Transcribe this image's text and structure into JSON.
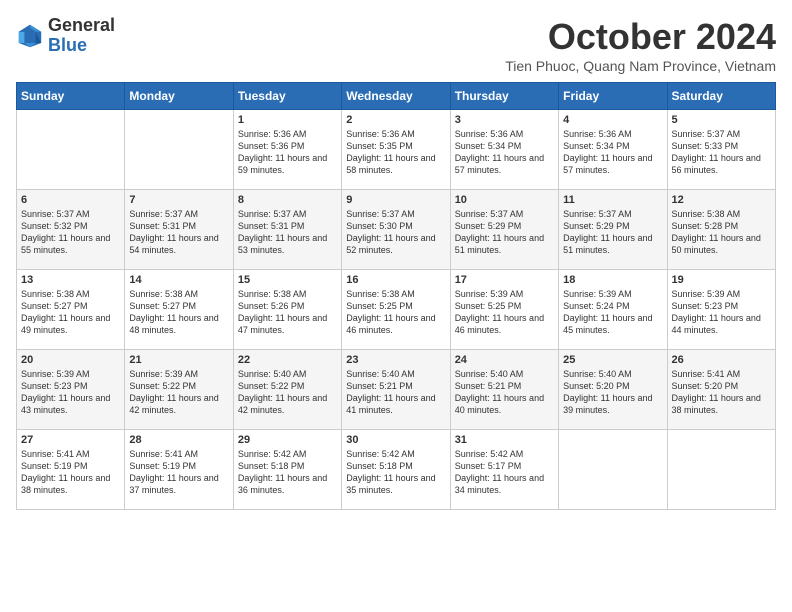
{
  "header": {
    "logo": {
      "general": "General",
      "blue": "Blue"
    },
    "title": "October 2024",
    "location": "Tien Phuoc, Quang Nam Province, Vietnam"
  },
  "weekdays": [
    "Sunday",
    "Monday",
    "Tuesday",
    "Wednesday",
    "Thursday",
    "Friday",
    "Saturday"
  ],
  "weeks": [
    [
      {
        "day": "",
        "sunrise": "",
        "sunset": "",
        "daylight": ""
      },
      {
        "day": "",
        "sunrise": "",
        "sunset": "",
        "daylight": ""
      },
      {
        "day": "1",
        "sunrise": "Sunrise: 5:36 AM",
        "sunset": "Sunset: 5:36 PM",
        "daylight": "Daylight: 11 hours and 59 minutes."
      },
      {
        "day": "2",
        "sunrise": "Sunrise: 5:36 AM",
        "sunset": "Sunset: 5:35 PM",
        "daylight": "Daylight: 11 hours and 58 minutes."
      },
      {
        "day": "3",
        "sunrise": "Sunrise: 5:36 AM",
        "sunset": "Sunset: 5:34 PM",
        "daylight": "Daylight: 11 hours and 57 minutes."
      },
      {
        "day": "4",
        "sunrise": "Sunrise: 5:36 AM",
        "sunset": "Sunset: 5:34 PM",
        "daylight": "Daylight: 11 hours and 57 minutes."
      },
      {
        "day": "5",
        "sunrise": "Sunrise: 5:37 AM",
        "sunset": "Sunset: 5:33 PM",
        "daylight": "Daylight: 11 hours and 56 minutes."
      }
    ],
    [
      {
        "day": "6",
        "sunrise": "Sunrise: 5:37 AM",
        "sunset": "Sunset: 5:32 PM",
        "daylight": "Daylight: 11 hours and 55 minutes."
      },
      {
        "day": "7",
        "sunrise": "Sunrise: 5:37 AM",
        "sunset": "Sunset: 5:31 PM",
        "daylight": "Daylight: 11 hours and 54 minutes."
      },
      {
        "day": "8",
        "sunrise": "Sunrise: 5:37 AM",
        "sunset": "Sunset: 5:31 PM",
        "daylight": "Daylight: 11 hours and 53 minutes."
      },
      {
        "day": "9",
        "sunrise": "Sunrise: 5:37 AM",
        "sunset": "Sunset: 5:30 PM",
        "daylight": "Daylight: 11 hours and 52 minutes."
      },
      {
        "day": "10",
        "sunrise": "Sunrise: 5:37 AM",
        "sunset": "Sunset: 5:29 PM",
        "daylight": "Daylight: 11 hours and 51 minutes."
      },
      {
        "day": "11",
        "sunrise": "Sunrise: 5:37 AM",
        "sunset": "Sunset: 5:29 PM",
        "daylight": "Daylight: 11 hours and 51 minutes."
      },
      {
        "day": "12",
        "sunrise": "Sunrise: 5:38 AM",
        "sunset": "Sunset: 5:28 PM",
        "daylight": "Daylight: 11 hours and 50 minutes."
      }
    ],
    [
      {
        "day": "13",
        "sunrise": "Sunrise: 5:38 AM",
        "sunset": "Sunset: 5:27 PM",
        "daylight": "Daylight: 11 hours and 49 minutes."
      },
      {
        "day": "14",
        "sunrise": "Sunrise: 5:38 AM",
        "sunset": "Sunset: 5:27 PM",
        "daylight": "Daylight: 11 hours and 48 minutes."
      },
      {
        "day": "15",
        "sunrise": "Sunrise: 5:38 AM",
        "sunset": "Sunset: 5:26 PM",
        "daylight": "Daylight: 11 hours and 47 minutes."
      },
      {
        "day": "16",
        "sunrise": "Sunrise: 5:38 AM",
        "sunset": "Sunset: 5:25 PM",
        "daylight": "Daylight: 11 hours and 46 minutes."
      },
      {
        "day": "17",
        "sunrise": "Sunrise: 5:39 AM",
        "sunset": "Sunset: 5:25 PM",
        "daylight": "Daylight: 11 hours and 46 minutes."
      },
      {
        "day": "18",
        "sunrise": "Sunrise: 5:39 AM",
        "sunset": "Sunset: 5:24 PM",
        "daylight": "Daylight: 11 hours and 45 minutes."
      },
      {
        "day": "19",
        "sunrise": "Sunrise: 5:39 AM",
        "sunset": "Sunset: 5:23 PM",
        "daylight": "Daylight: 11 hours and 44 minutes."
      }
    ],
    [
      {
        "day": "20",
        "sunrise": "Sunrise: 5:39 AM",
        "sunset": "Sunset: 5:23 PM",
        "daylight": "Daylight: 11 hours and 43 minutes."
      },
      {
        "day": "21",
        "sunrise": "Sunrise: 5:39 AM",
        "sunset": "Sunset: 5:22 PM",
        "daylight": "Daylight: 11 hours and 42 minutes."
      },
      {
        "day": "22",
        "sunrise": "Sunrise: 5:40 AM",
        "sunset": "Sunset: 5:22 PM",
        "daylight": "Daylight: 11 hours and 42 minutes."
      },
      {
        "day": "23",
        "sunrise": "Sunrise: 5:40 AM",
        "sunset": "Sunset: 5:21 PM",
        "daylight": "Daylight: 11 hours and 41 minutes."
      },
      {
        "day": "24",
        "sunrise": "Sunrise: 5:40 AM",
        "sunset": "Sunset: 5:21 PM",
        "daylight": "Daylight: 11 hours and 40 minutes."
      },
      {
        "day": "25",
        "sunrise": "Sunrise: 5:40 AM",
        "sunset": "Sunset: 5:20 PM",
        "daylight": "Daylight: 11 hours and 39 minutes."
      },
      {
        "day": "26",
        "sunrise": "Sunrise: 5:41 AM",
        "sunset": "Sunset: 5:20 PM",
        "daylight": "Daylight: 11 hours and 38 minutes."
      }
    ],
    [
      {
        "day": "27",
        "sunrise": "Sunrise: 5:41 AM",
        "sunset": "Sunset: 5:19 PM",
        "daylight": "Daylight: 11 hours and 38 minutes."
      },
      {
        "day": "28",
        "sunrise": "Sunrise: 5:41 AM",
        "sunset": "Sunset: 5:19 PM",
        "daylight": "Daylight: 11 hours and 37 minutes."
      },
      {
        "day": "29",
        "sunrise": "Sunrise: 5:42 AM",
        "sunset": "Sunset: 5:18 PM",
        "daylight": "Daylight: 11 hours and 36 minutes."
      },
      {
        "day": "30",
        "sunrise": "Sunrise: 5:42 AM",
        "sunset": "Sunset: 5:18 PM",
        "daylight": "Daylight: 11 hours and 35 minutes."
      },
      {
        "day": "31",
        "sunrise": "Sunrise: 5:42 AM",
        "sunset": "Sunset: 5:17 PM",
        "daylight": "Daylight: 11 hours and 34 minutes."
      },
      {
        "day": "",
        "sunrise": "",
        "sunset": "",
        "daylight": ""
      },
      {
        "day": "",
        "sunrise": "",
        "sunset": "",
        "daylight": ""
      }
    ]
  ]
}
